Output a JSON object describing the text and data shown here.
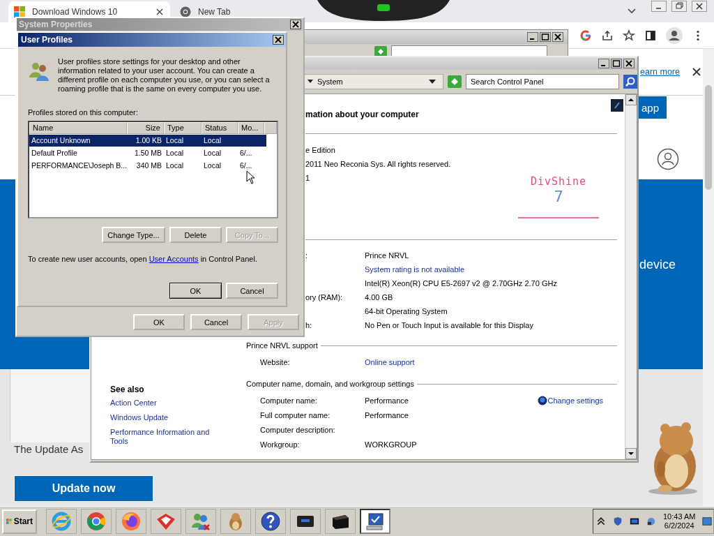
{
  "browser": {
    "tabs": [
      {
        "label": "Download Windows 10",
        "selected": true
      },
      {
        "label": "New Tab",
        "selected": false
      }
    ],
    "page": {
      "banner_link": "earn more",
      "app_button": "app",
      "band_text": "device",
      "update_text": "The Update As",
      "update_button": "Update now"
    }
  },
  "control_panel": {
    "breadcrumb": "System",
    "search": {
      "placeholder": "Search Control Panel"
    },
    "heading": "mation about your computer",
    "edition_lines": [
      "e Edition",
      "2011 Neo Reconia Sys.  All rights reserved.",
      "1"
    ],
    "logo": {
      "name": "DivShine",
      "version": "7"
    },
    "system_rows": [
      {
        "label": ":",
        "value": "Prince NRVL",
        "kind": "text"
      },
      {
        "value": "System rating is not available",
        "kind": "link"
      },
      {
        "value": "Intel(R) Xeon(R) CPU E5-2697 v2 @ 2.70GHz   2.70 GHz",
        "kind": "text"
      },
      {
        "label": "ory (RAM):",
        "value": "4.00 GB",
        "kind": "text"
      },
      {
        "value": "64-bit Operating System",
        "kind": "text"
      },
      {
        "label": "h:",
        "value": "No Pen or Touch Input is available for this Display",
        "kind": "text"
      }
    ],
    "support": {
      "title": "Prince NRVL support",
      "rows": [
        {
          "label": "Website:",
          "value": "Online support",
          "kind": "link"
        }
      ]
    },
    "computer": {
      "title": "Computer name, domain, and workgroup settings",
      "change_settings": "Change settings",
      "rows": [
        {
          "label": "Computer name:",
          "value": "Performance"
        },
        {
          "label": "Full computer name:",
          "value": "Performance"
        },
        {
          "label": "Computer description:"
        },
        {
          "label": "Workgroup:",
          "value": "WORKGROUP"
        }
      ]
    },
    "see_also": {
      "title": "See also",
      "links": [
        "Action Center",
        "Windows Update",
        "Performance Information and Tools"
      ]
    }
  },
  "system_properties": {
    "title": "System Properties",
    "buttons": [
      {
        "label": "OK",
        "disabled": false
      },
      {
        "label": "Cancel",
        "disabled": false
      },
      {
        "label": "Apply",
        "disabled": true
      }
    ]
  },
  "user_profiles": {
    "title": "User Profiles",
    "description": "User profiles store settings for your desktop and other information related to your user account. You can create a different profile on each computer you use, or you can select a roaming profile that is the same on every computer you use.",
    "list_label": "Profiles stored on this computer:",
    "columns": [
      "Name",
      "Size",
      "Type",
      "Status",
      "Mo..."
    ],
    "rows": [
      {
        "cells": [
          "Account Unknown",
          "1.00 KB",
          "Local",
          "Local"
        ],
        "selected": true
      },
      {
        "cells": [
          "Default Profile",
          "1.50 MB",
          "Local",
          "Local",
          "6/..."
        ],
        "selected": false
      },
      {
        "cells": [
          "PERFORMANCE\\Joseph B...",
          "340 MB",
          "Local",
          "Local",
          "6/..."
        ],
        "selected": false
      }
    ],
    "actions": [
      {
        "label": "Change Type...",
        "disabled": false
      },
      {
        "label": "Delete",
        "disabled": false
      },
      {
        "label": "Copy To...",
        "disabled": true
      }
    ],
    "footer": {
      "before": "To create new user accounts, open ",
      "link": "User Accounts",
      "after": " in Control Panel."
    },
    "buttons": [
      {
        "label": "OK",
        "default": true
      },
      {
        "label": "Cancel",
        "default": false
      }
    ]
  },
  "taskbar": {
    "start": "Start",
    "buttons": [
      {
        "selected": false
      },
      {
        "selected": false
      },
      {
        "selected": false
      },
      {
        "selected": false
      },
      {
        "selected": false
      },
      {
        "selected": false
      },
      {
        "selected": false
      },
      {
        "selected": false
      },
      {
        "selected": false
      },
      {
        "selected": true
      }
    ],
    "clock": {
      "time": "10:43 AM",
      "date": "6/2/2024"
    }
  }
}
